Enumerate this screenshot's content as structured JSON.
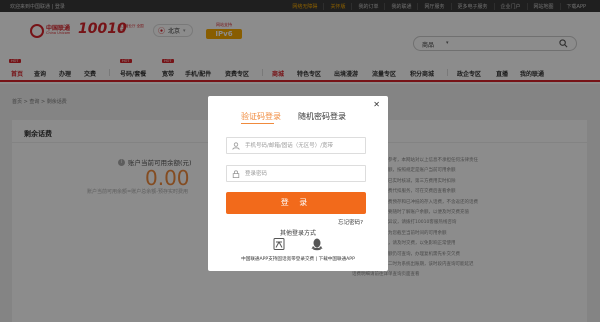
{
  "topbar": {
    "welcome": "欢迎来到中国联通",
    "login_link": "登录",
    "links": [
      "网络无障碍",
      "关怀版",
      "我的订单",
      "我的联通",
      "网厅服务",
      "更多电子服务",
      "企业门户",
      "网站地图",
      "下载APP"
    ]
  },
  "header": {
    "brand": "中国联通",
    "brand_sub": "China Unicom",
    "hotline": "10010",
    "hotline_sub": "网上营业厅 全国服务",
    "city": "北京",
    "ipv6_label": "网站支持",
    "ipv6_badge": "IPv6",
    "search_category": "商品"
  },
  "nav": {
    "items": [
      "首页",
      "查询",
      "办理",
      "交费",
      "号码/套餐",
      "宽带",
      "手机/配件",
      "资费专区",
      "商城",
      "特色专区",
      "出境漫游",
      "流量专区",
      "积分商城",
      "政企专区",
      "直播",
      "我的联通"
    ],
    "hot_label": "HOT"
  },
  "breadcrumb": "首页 > 查询 > 剩余话费",
  "balance": {
    "card_title": "剩余话费",
    "label": "账户当前可用余额(元)",
    "value": "0.00",
    "note": "账户当前可用余额=账户总余额-预存实时费用"
  },
  "right_notes": [
    "查询结果页面仅供参考，本网站对以上信息不承担任何法律责任",
    "您查询的是实时余额，按照规定是账户当前可用余额",
    "公司对您当月消费已实时核减，第三方费用实时扣除",
    "如您开通托收、话费代扣服务，可在交费后查看余额",
    "可用余额含当月话费预存和已冲抵的存入话费，不含返还的话费",
    "付费用户可根据需要随时了解账户余额，以便及时交费充值",
    "如您对查询结果有异议，请拨打10010客服热线咨询",
    "用户当前账户余额为您截至当前时间的可用余额",
    "当前余额小于零时，请及时交费，以免影响正常使用",
    "暂停服务后账户余额仍可查询，办理复机需先补交欠费",
    "每月一号的零时至二时为系统出账期，该时段内查询可能延迟",
    "话费明细请前往详单查询页面查看"
  ],
  "modal": {
    "tab_sms": "验证码登录",
    "tab_password": "随机密码登录",
    "phone_placeholder": "手机号码/邮箱/固话（无区号）/宽带",
    "password_placeholder": "登录密码",
    "login_button": "登 录",
    "forgot": "忘记密码?",
    "other_title": "其他登录方式",
    "bottom_note": "中国联通APP支持固话宽带登录交费 | 下载中国联通APP"
  },
  "colors": {
    "brand_red": "#d8232a",
    "accent_orange": "#f26a1b",
    "balance_orange": "#f08a3c"
  }
}
